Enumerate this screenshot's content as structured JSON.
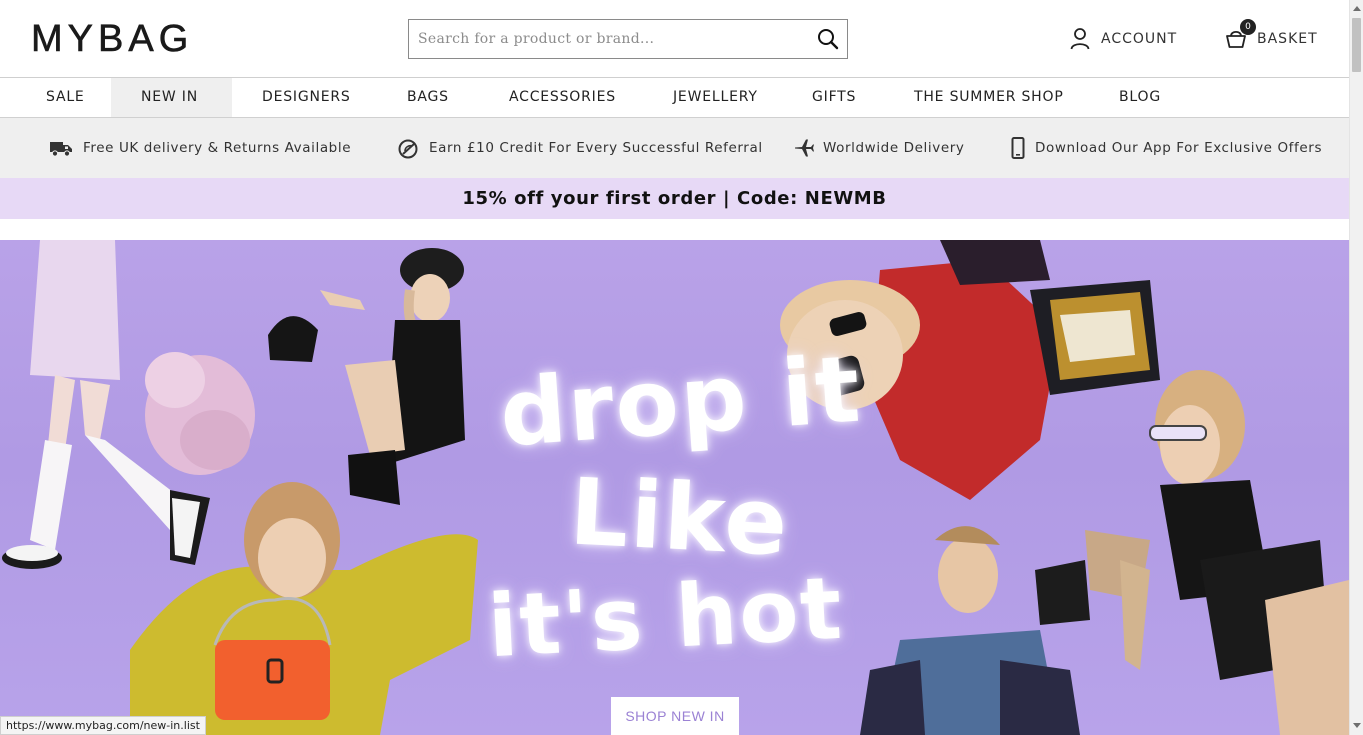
{
  "header": {
    "logo": "MYBAG",
    "search": {
      "placeholder": "Search for a product or brand..."
    },
    "account_label": "ACCOUNT",
    "basket_label": "BASKET",
    "basket_count": "0"
  },
  "nav": {
    "items": [
      {
        "label": "SALE"
      },
      {
        "label": "NEW IN",
        "active": true
      },
      {
        "label": "DESIGNERS"
      },
      {
        "label": "BAGS"
      },
      {
        "label": "ACCESSORIES"
      },
      {
        "label": "JEWELLERY"
      },
      {
        "label": "GIFTS"
      },
      {
        "label": "THE SUMMER SHOP"
      },
      {
        "label": "BLOG"
      }
    ]
  },
  "usp": {
    "items": [
      {
        "icon": "truck-icon",
        "label": "Free UK delivery & Returns Available"
      },
      {
        "icon": "referral-icon",
        "label": "Earn £10 Credit For Every Successful Referral"
      },
      {
        "icon": "plane-icon",
        "label": "Worldwide Delivery"
      },
      {
        "icon": "phone-icon",
        "label": "Download Our App For Exclusive Offers"
      }
    ]
  },
  "promo": {
    "text": "15% off your first order | Code: NEWMB"
  },
  "hero": {
    "line1": "drop it",
    "line2": "Like",
    "line3": "it's hot",
    "cta": "SHOP NEW IN",
    "background": "#b5a0e8"
  },
  "status_url": "https://www.mybag.com/new-in.list"
}
